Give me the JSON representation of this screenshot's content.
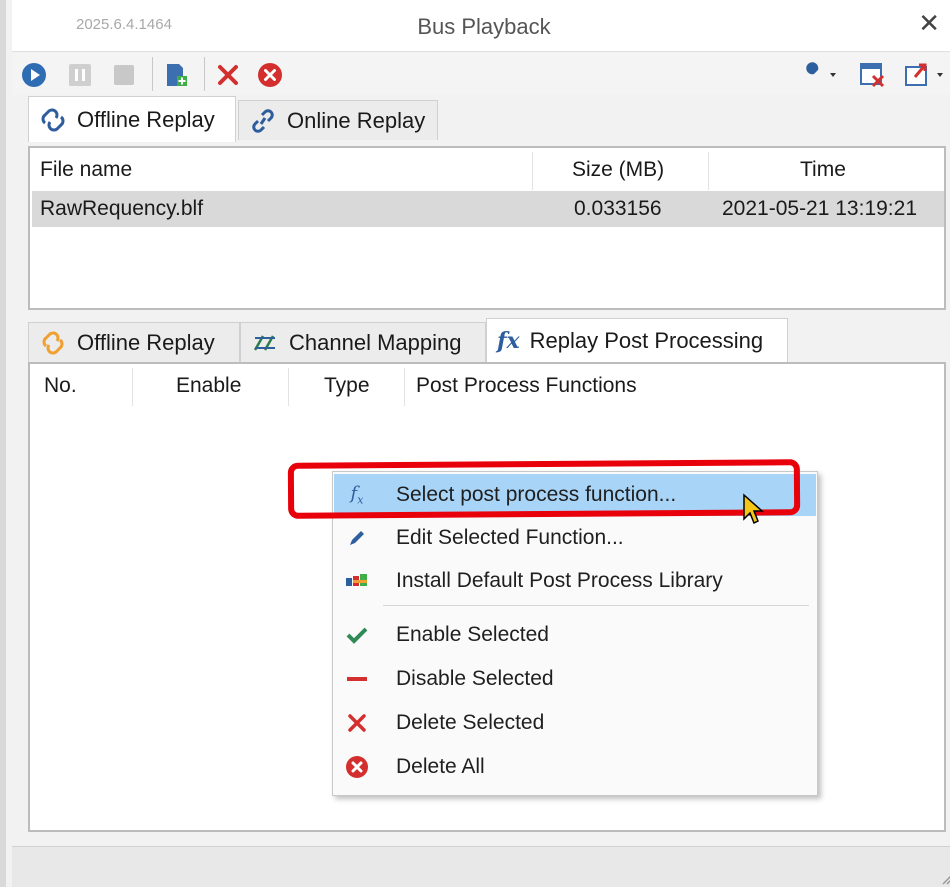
{
  "window": {
    "version": "2025.6.4.1464",
    "title": "Bus Playback",
    "close_glyph": "✕"
  },
  "toolbar": {
    "buttons": [
      "play-icon",
      "pause-icon",
      "stop-icon",
      "add-file-icon",
      "delete-icon",
      "delete-all-icon",
      "wrench-icon",
      "clear-window-icon",
      "export-icon"
    ]
  },
  "top_tabs": [
    {
      "label": "Offline Replay",
      "icon": "offline-replay-link-icon",
      "active": true
    },
    {
      "label": "Online Replay",
      "icon": "online-replay-link-icon",
      "active": false
    }
  ],
  "file_table": {
    "headers": [
      "File name",
      "Size (MB)",
      "Time"
    ],
    "rows": [
      {
        "name": "RawRequency.blf",
        "size": "0.033156",
        "time": "2021-05-21 13:19:21"
      }
    ]
  },
  "bottom_tabs": [
    {
      "label": "Offline Replay",
      "icon": "offline-replay-icon"
    },
    {
      "label": "Channel Mapping",
      "icon": "channel-mapping-icon"
    },
    {
      "label": "Replay Post Processing",
      "icon": "fx-icon",
      "active": true
    }
  ],
  "post_table": {
    "headers": [
      "No.",
      "Enable",
      "Type",
      "Post Process Functions"
    ]
  },
  "context_menu": {
    "items": [
      {
        "label": "Select post process function...",
        "icon": "fx-icon"
      },
      {
        "label": "Edit Selected Function...",
        "icon": "pencil-icon"
      },
      {
        "label": "Install Default Post Process Library",
        "icon": "library-icon"
      },
      {
        "label": "Enable Selected",
        "icon": "checkmark-icon"
      },
      {
        "label": "Disable Selected",
        "icon": "minus-icon"
      },
      {
        "label": "Delete Selected",
        "icon": "delete-x-icon"
      },
      {
        "label": "Delete All",
        "icon": "delete-all-circle-icon"
      }
    ]
  },
  "colors": {
    "highlight": "#a8d4f8",
    "annotation_red": "#e8000b",
    "play_blue": "#2e6db4",
    "delete_red": "#d32f2f"
  }
}
